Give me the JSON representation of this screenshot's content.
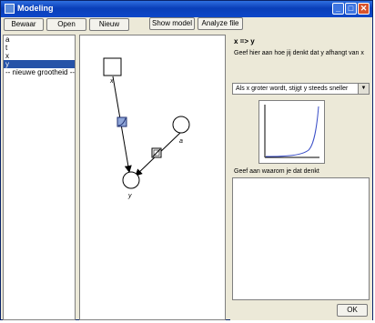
{
  "window": {
    "title": "Modeling",
    "minimize": "_",
    "maximize": "□",
    "close": "✕"
  },
  "toolbar": {
    "save_label": "Bewaar",
    "open_label": "Open",
    "new_label": "Nieuw",
    "show_model_label": "Show model",
    "analyze_label": "Analyze file"
  },
  "quantities": [
    {
      "label": "a",
      "selected": false
    },
    {
      "label": "t",
      "selected": false
    },
    {
      "label": "x",
      "selected": false
    },
    {
      "label": "y",
      "selected": true
    },
    {
      "label": " -- nieuwe grootheid --",
      "selected": false
    }
  ],
  "model": {
    "nodes": {
      "x": "x",
      "a": "a",
      "y": "y"
    }
  },
  "relation": {
    "title": "x => y",
    "question": "Geef hier aan hoe jij denkt dat y afhangt van x",
    "selected_option": "Als x groter wordt, stijgt y steeds sneller",
    "explain_label": "Geef aan waarom je dat denkt",
    "explain_value": "",
    "ok_label": "OK"
  },
  "colors": {
    "titlebar": "#0a3fb8",
    "selection": "#2653a8",
    "curve": "#3b4fc8",
    "relation_icon": "#8fa6d8"
  }
}
